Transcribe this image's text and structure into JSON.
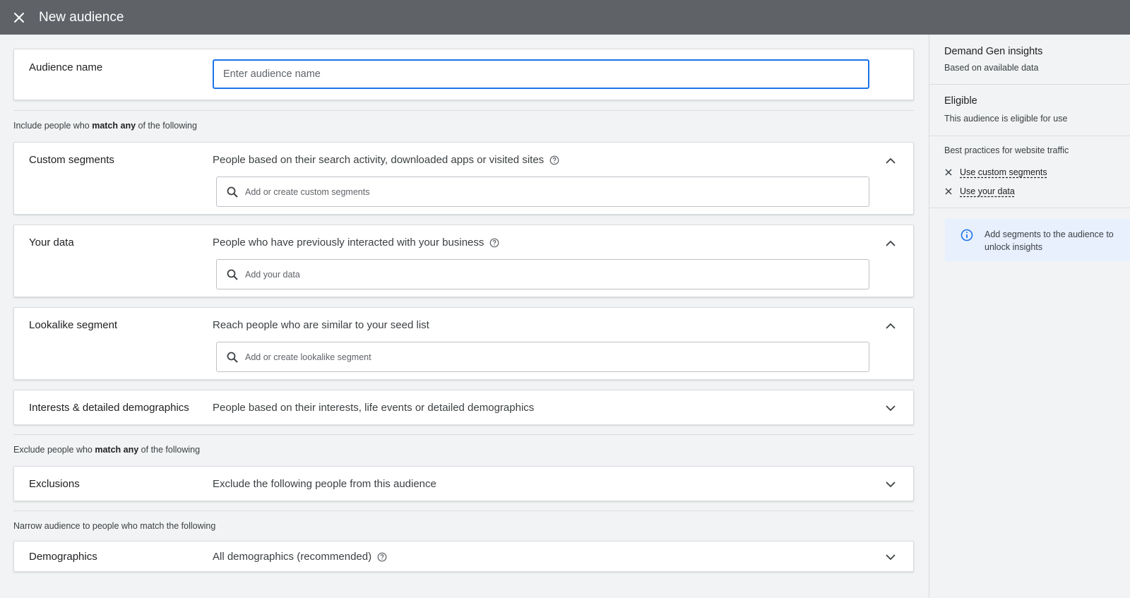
{
  "header": {
    "title": "New audience",
    "close_icon": "close-icon"
  },
  "audience_name": {
    "label": "Audience name",
    "placeholder": "Enter audience name"
  },
  "include_section": {
    "prefix": "Include people who ",
    "emphasis": "match any",
    "suffix": " of the following"
  },
  "cards": {
    "custom_segments": {
      "label": "Custom segments",
      "description": "People based on their search activity, downloaded apps or visited sites",
      "search_placeholder": "Add or create custom segments",
      "expanded": true
    },
    "your_data": {
      "label": "Your data",
      "description": "People who have previously interacted with your business",
      "search_placeholder": "Add your data",
      "expanded": true
    },
    "lookalike": {
      "label": "Lookalike segment",
      "description": "Reach people who are similar to your seed list",
      "search_placeholder": "Add or create lookalike segment",
      "expanded": true
    },
    "interests": {
      "label": "Interests & detailed demographics",
      "description": "People based on their interests, life events or detailed demographics",
      "expanded": false
    },
    "exclusions": {
      "label": "Exclusions",
      "description": "Exclude the following people from this audience",
      "expanded": false
    },
    "demographics": {
      "label": "Demographics",
      "description": "All demographics (recommended)",
      "expanded": false
    }
  },
  "exclude_section": {
    "prefix": "Exclude people who ",
    "emphasis": "match any",
    "suffix": " of the following"
  },
  "narrow_section": {
    "text": "Narrow audience to people who match the following"
  },
  "sidebar": {
    "insights_title": "Demand Gen insights",
    "insights_sub": "Based on available data",
    "eligible_title": "Eligible",
    "eligible_sub": "This audience is eligible for use",
    "best_practices_title": "Best practices for website traffic",
    "best_practices": [
      "Use custom segments",
      "Use your data"
    ],
    "info_text": "Add segments to the audience to unlock insights"
  },
  "colors": {
    "topbar": "#5f6368",
    "accent": "#1a73e8",
    "info_bg": "#e8f0fe",
    "background": "#f1f3f4"
  }
}
